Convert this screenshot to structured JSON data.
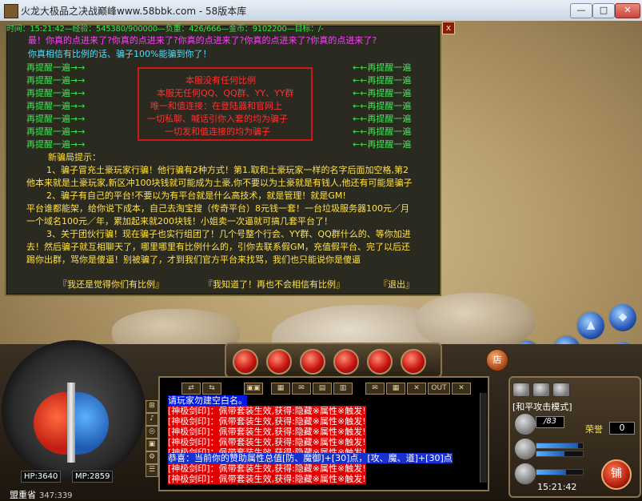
{
  "window": {
    "title": "火龙大极品之决战巅峰www.58bbk.com - 58版本库",
    "minimize": "—",
    "maximize": "□",
    "close": "✕"
  },
  "hud": {
    "status_line": "时间：15:21:42—经验：545380/900000—负重：426/666—金币：9102200—目标：/-"
  },
  "dialog": {
    "close": "x",
    "warn1": "最！你真的点进来了?你真的点进来了?你真的点进来了?你真的点进来了?你真的点进来了?",
    "warn2": "你真相信有比例的话、骗子100%能骗到你了！",
    "left_repeat": [
      "再提醒一遍→→",
      "再提醒一遍→→",
      "再提醒一遍→→",
      "再提醒一遍→→",
      "再提醒一遍→→",
      "再提醒一遍→→",
      "再提醒一遍→→"
    ],
    "right_repeat": [
      "←←再提醒一遍",
      "←←再提醒一遍",
      "←←再提醒一遍",
      "←←再提醒一遍",
      "←←再提醒一遍",
      "←←再提醒一遍",
      "←←再提醒一遍"
    ],
    "notice": [
      "本服没有任何比例",
      "本服无任何QQ、QQ群、YY、YY群",
      "唯一和值连接：在登陆器和官网上",
      "一切私聊、喊话引你入套的均为骗子",
      "一切发和值连接的均为骗子"
    ],
    "scam_title": "新骗局提示：",
    "scam_paragraphs": [
      "1、骗子冒充土豪玩家行骗！他行骗有2种方式！第1.取和土豪玩家一样的名字后面加空格,第2",
      "他本来就是土豪玩家,新区冲100块钱就可能成为土豪,你不要以为土豪就是有钱人,他还有可能是骗子",
      "2、骗子有自己的平台!不要以为有平台就是什么高技术，就是管理！就是GM!",
      "平台谁都能架，给你说下成本，自己去淘宝搜（传奇平台）8元钱一套！一台垃圾服务器100元／月",
      "一个域名100元／年，累加起来就200块钱！小姐卖一次逼就可搞几套平台了！",
      "3、关于团伙行骗！现在骗子也实行组团了！几个号整个行会、YY群、QQ群什么的、等你加进",
      "去！然后骗子就互相聊天了，哪里哪里有比例什么的，引你去联系假GM，充值假平台、完了以后还",
      "踢你出群，骂你是傻逼！别被骗了，才到我们官方平台来找骂，我们也只能说你是傻逼"
    ],
    "link1": "『我还是觉得你们有比例』",
    "link2": "『我知道了！再也不会相信有比例』",
    "link3": "『退出』"
  },
  "player": {
    "hp": "HP:3640",
    "mp": "MP:2859",
    "map_name": "盟重省",
    "coords": "347:339"
  },
  "chat": {
    "toolbar": [
      "◀▶",
      "⇄",
      "⇆",
      "▣▣",
      "▦",
      "✉",
      "▤",
      "▥",
      "▦",
      "✉",
      "▦",
      "▤",
      "✕",
      "OUT",
      "✕"
    ],
    "lines": [
      {
        "text": "请玩家勿建空白名。",
        "style": "blue"
      },
      {
        "text": "[神极剑印]：佩带套装生效,获得:隐藏※属性※触发!",
        "style": "red"
      },
      {
        "text": "[神极剑印]：佩带套装生效,获得:隐藏※属性※触发!",
        "style": "red"
      },
      {
        "text": "[神极剑印]：佩带套装生效,获得:隐藏※属性※触发!",
        "style": "red"
      },
      {
        "text": "[神极剑印]：佩带套装生效,获得:隐藏※属性※触发!",
        "style": "red"
      },
      {
        "text": "[神极剑印]：佩带套装生效,获得:隐藏※属性※触发!",
        "style": "red"
      },
      {
        "text": "恭喜：当前你的赞助属性总值[防、魔御]+[30]点，[攻、魔、道]+[30]点",
        "style": "sys"
      },
      {
        "text": "[神极剑印]：佩带套装生效,获得:隐藏※属性※触发!",
        "style": "red"
      },
      {
        "text": "[神极剑印]：佩带套装生效,获得:隐藏※属性※触发!",
        "style": "red"
      }
    ]
  },
  "right_panel": {
    "mode": "[和平攻击模式]",
    "signature": "/83",
    "reputation_label": "荣誉",
    "reputation_value": "0",
    "clock": "15:21:42",
    "shop": "铺",
    "shop_side": "店"
  },
  "side_icons": [
    "⊞",
    "♪",
    "◎",
    "▣",
    "⚙",
    "☰",
    "✦"
  ],
  "top_right_buttons": [
    "▲",
    "◆",
    "✧",
    "⊕",
    "◐"
  ]
}
